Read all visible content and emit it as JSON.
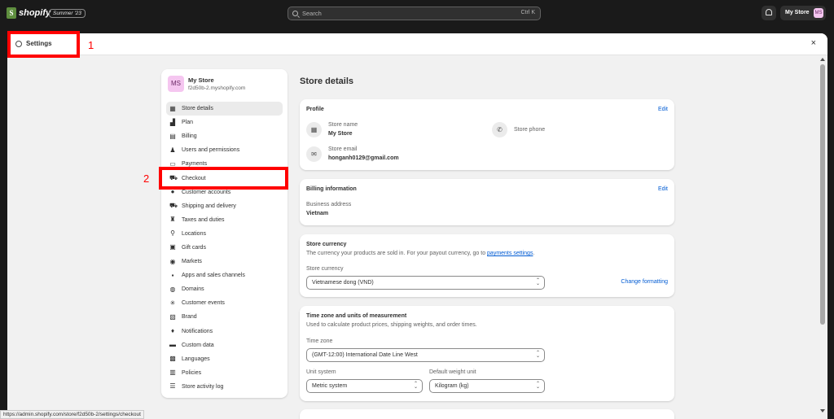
{
  "topbar": {
    "logo_glyph": "S",
    "brand": "shopify",
    "edition": "Summer '23",
    "search_placeholder": "Search",
    "search_shortcut": "Ctrl K",
    "store_label": "My Store",
    "store_initials": "MS"
  },
  "modal": {
    "title": "Settings",
    "close": "×"
  },
  "sidebar": {
    "avatar": "MS",
    "store_name": "My Store",
    "store_url": "f2d50b-2.myshopify.com",
    "items": [
      {
        "label": "Store details",
        "icon": "store-icon",
        "glyph": "▦"
      },
      {
        "label": "Plan",
        "icon": "plan-icon",
        "glyph": "▟"
      },
      {
        "label": "Billing",
        "icon": "billing-icon",
        "glyph": "▤"
      },
      {
        "label": "Users and permissions",
        "icon": "users-icon",
        "glyph": "♟"
      },
      {
        "label": "Payments",
        "icon": "payments-icon",
        "glyph": "▭"
      },
      {
        "label": "Checkout",
        "icon": "cart-icon",
        "glyph": "⛟"
      },
      {
        "label": "Customer accounts",
        "icon": "customer-icon",
        "glyph": "●"
      },
      {
        "label": "Shipping and delivery",
        "icon": "truck-icon",
        "glyph": "⛟"
      },
      {
        "label": "Taxes and duties",
        "icon": "taxes-icon",
        "glyph": "♜"
      },
      {
        "label": "Locations",
        "icon": "location-icon",
        "glyph": "⚲"
      },
      {
        "label": "Gift cards",
        "icon": "gift-card-icon",
        "glyph": "▣"
      },
      {
        "label": "Markets",
        "icon": "markets-icon",
        "glyph": "◉"
      },
      {
        "label": "Apps and sales channels",
        "icon": "apps-icon",
        "glyph": "▪"
      },
      {
        "label": "Domains",
        "icon": "domains-icon",
        "glyph": "◍"
      },
      {
        "label": "Customer events",
        "icon": "events-icon",
        "glyph": "✳"
      },
      {
        "label": "Brand",
        "icon": "brand-icon",
        "glyph": "▧"
      },
      {
        "label": "Notifications",
        "icon": "bell-icon",
        "glyph": "♦"
      },
      {
        "label": "Custom data",
        "icon": "custom-data-icon",
        "glyph": "▬"
      },
      {
        "label": "Languages",
        "icon": "languages-icon",
        "glyph": "▩"
      },
      {
        "label": "Policies",
        "icon": "policies-icon",
        "glyph": "▥"
      },
      {
        "label": "Store activity log",
        "icon": "activity-log-icon",
        "glyph": "☰"
      }
    ]
  },
  "content": {
    "title": "Store details",
    "profile": {
      "title": "Profile",
      "edit": "Edit",
      "store_name_label": "Store name",
      "store_name": "My Store",
      "store_phone_label": "Store phone",
      "store_email_label": "Store email",
      "store_email": "honganh0129@gmail.com"
    },
    "billing": {
      "title": "Billing information",
      "edit": "Edit",
      "address_label": "Business address",
      "address": "Vietnam"
    },
    "currency": {
      "title": "Store currency",
      "desc_prefix": "The currency your products are sold in. For your payout currency, go to ",
      "desc_link": "payments settings",
      "desc_suffix": ".",
      "field_label": "Store currency",
      "value": "Vietnamese dong (VND)",
      "change_formatting": "Change formatting"
    },
    "timezone": {
      "title": "Time zone and units of measurement",
      "desc": "Used to calculate product prices, shipping weights, and order times.",
      "tz_label": "Time zone",
      "tz_value": "(GMT-12:00) International Date Line West",
      "unit_label": "Unit system",
      "unit_value": "Metric system",
      "weight_label": "Default weight unit",
      "weight_value": "Kilogram (kg)"
    }
  },
  "annotations": {
    "one": "1",
    "two": "2"
  },
  "status_url": "https://admin.shopify.com/store/f2d50b-2/settings/checkout"
}
